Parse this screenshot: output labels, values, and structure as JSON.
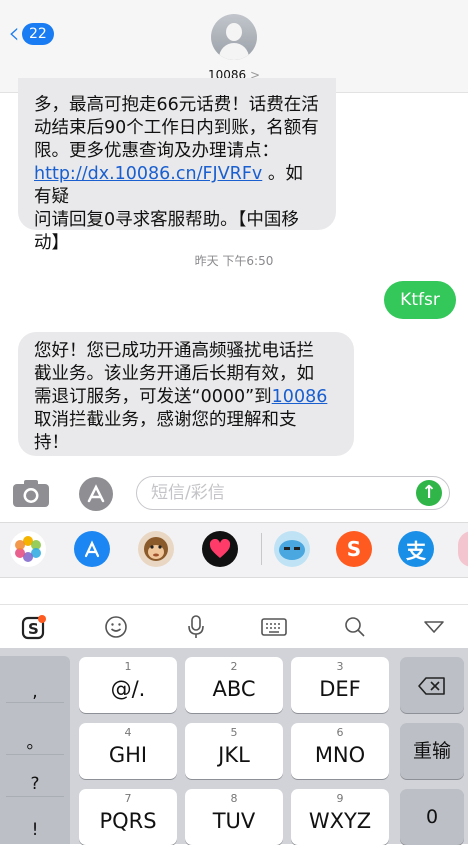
{
  "header": {
    "back_badge": "22",
    "contact_name": "10086",
    "contact_chevron": ">"
  },
  "messages": {
    "first_lines": [
      "多，最高可抱走66元话费！话费在活",
      "动结束后90个工作日内到账，名额有",
      "限。更多优惠查询及办理请点：",
      "http://dx.10086.cn/FJVRFv",
      " 。如有疑",
      "问请回复0寻求客服帮助。【中国移",
      "动】"
    ],
    "timestamp": "昨天 下午6:50",
    "outgoing": "Ktfsr",
    "second_lines": [
      "您好！您已成功开通高频骚扰电话拦",
      "截业务。该业务开通后长期有效，如",
      "需退订服务，可发送“0000”到",
      "10086",
      "取消拦截业务，感谢您的理解和支",
      "持！"
    ]
  },
  "composer": {
    "placeholder": "短信/彩信"
  },
  "keyboard": {
    "symbols": [
      ",",
      "。",
      "?",
      "!"
    ],
    "keys": [
      {
        "num": "1",
        "label": "@/."
      },
      {
        "num": "2",
        "label": "ABC"
      },
      {
        "num": "3",
        "label": "DEF"
      },
      {
        "num": "4",
        "label": "GHI"
      },
      {
        "num": "5",
        "label": "JKL"
      },
      {
        "num": "6",
        "label": "MNO"
      },
      {
        "num": "7",
        "label": "PQRS"
      },
      {
        "num": "8",
        "label": "TUV"
      },
      {
        "num": "9",
        "label": "WXYZ"
      }
    ],
    "reenter": "重输",
    "zero": "0"
  },
  "icons": {
    "back": "chevron-left-icon",
    "camera": "camera-icon",
    "appstore": "appstore-icon",
    "send": "arrow-up-icon",
    "photos": "photos-icon",
    "monkey": "monkey-icon",
    "heart": "heart-icon",
    "face": "face-icon",
    "sogou": "sogou-icon",
    "alipay": "alipay-icon",
    "emoji": "smiley-icon",
    "mic": "mic-icon",
    "keyboard": "keyboard-icon",
    "search": "search-icon",
    "collapse": "collapse-icon",
    "delete": "delete-icon"
  },
  "colors": {
    "accent": "#1a7cf3",
    "outgoing": "#34c759",
    "incoming": "#e9e9eb"
  }
}
